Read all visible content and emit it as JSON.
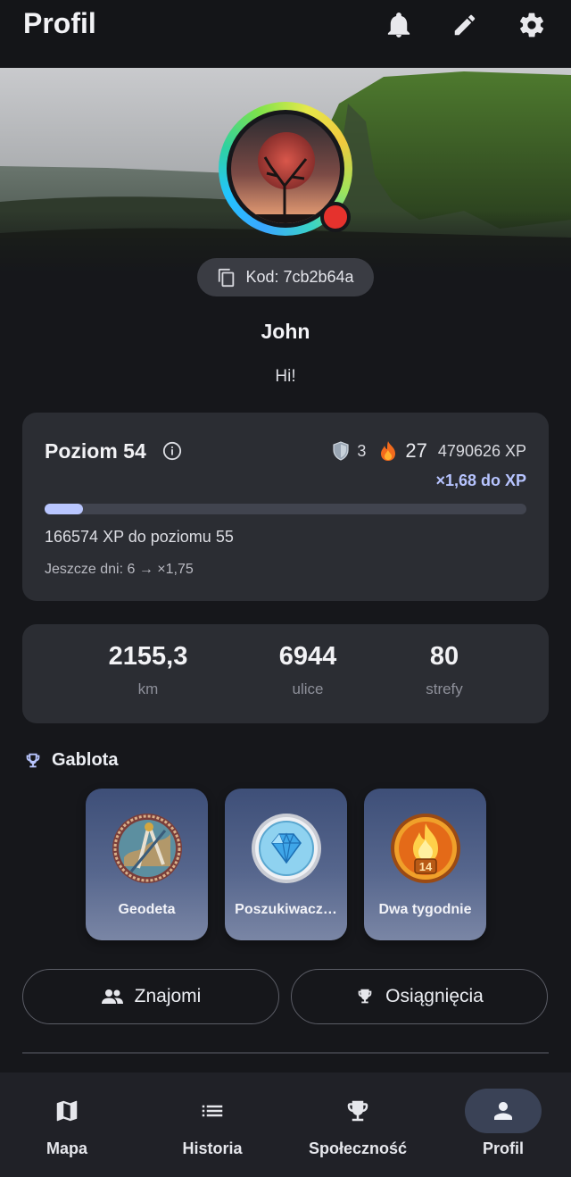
{
  "app": {
    "title": "Profil"
  },
  "topbar": {
    "icons": [
      "bell-icon",
      "pencil-icon",
      "gear-icon"
    ]
  },
  "profile": {
    "code_label": "Kod: 7cb2b64a",
    "name": "John",
    "bio": "Hi!",
    "status_color": "#e5322d"
  },
  "level": {
    "title": "Poziom 54",
    "shields": "3",
    "streak": "27",
    "total_xp": "4790626 XP",
    "multiplier": "×1,68 do XP",
    "progress_fraction": 0.08,
    "to_next": "166574 XP do poziomu 55",
    "days_note": "Jeszcze dni: 6 → ×1,75"
  },
  "stats": [
    {
      "value": "2155,3",
      "label": "km"
    },
    {
      "value": "6944",
      "label": "ulice"
    },
    {
      "value": "80",
      "label": "strefy"
    }
  ],
  "gablota": {
    "title": "Gablota",
    "badges": [
      {
        "name": "Geodeta",
        "icon": "compass-medal-icon"
      },
      {
        "name": "Poszukiwacz…",
        "icon": "diamond-medal-icon"
      },
      {
        "name": "Dwa tygodnie",
        "icon": "flame-14-medal-icon",
        "number": "14"
      }
    ]
  },
  "buttons": {
    "friends": "Znajomi",
    "achievements": "Osiągnięcia"
  },
  "nav": [
    {
      "label": "Mapa",
      "icon": "map-icon"
    },
    {
      "label": "Historia",
      "icon": "list-icon"
    },
    {
      "label": "Społeczność",
      "icon": "trophy-icon"
    },
    {
      "label": "Profil",
      "icon": "person-icon",
      "active": true
    }
  ],
  "colors": {
    "background": "#16171b",
    "card": "#2b2d33",
    "accent": "#b9c6ff",
    "multiplier": "#b7c4ff"
  }
}
